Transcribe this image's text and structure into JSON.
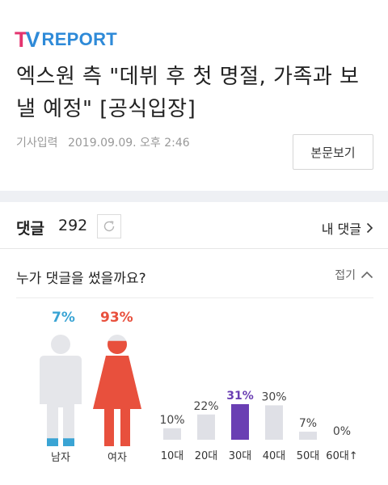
{
  "brand": {
    "logo_t": "T",
    "logo_v": "V",
    "logo_report": "REPORT"
  },
  "article": {
    "title": "엑스원 측 \"데뷔 후 첫 명절, 가족과 보낼 예정\" [공식입장]",
    "input_label": "기사입력",
    "input_datetime": "2019.09.09. 오후 2:46",
    "view_original_label": "본문보기"
  },
  "comments": {
    "title": "댓글",
    "count": "292",
    "my_comments_label": "내 댓글"
  },
  "stats": {
    "question": "누가 댓글을 썼을까요?",
    "fold_label": "접기",
    "gender": {
      "male": {
        "label": "남자",
        "percent_text": "7%",
        "value": 7
      },
      "female": {
        "label": "여자",
        "percent_text": "93%",
        "value": 93
      }
    }
  },
  "colors": {
    "male": "#3aa4d4",
    "female": "#e8503d",
    "age_highlight": "#6a3fb3",
    "age_bar": "#dfe0e6"
  },
  "chart_data": {
    "type": "bar",
    "categories": [
      "10대",
      "20대",
      "30대",
      "40대",
      "50대",
      "60대↑"
    ],
    "values": [
      10,
      22,
      31,
      30,
      7,
      0
    ],
    "value_labels": [
      "10%",
      "22%",
      "31%",
      "30%",
      "7%",
      "0%"
    ],
    "highlight_index": 2,
    "ylim": [
      0,
      31
    ],
    "grid": false,
    "legend": "none"
  }
}
